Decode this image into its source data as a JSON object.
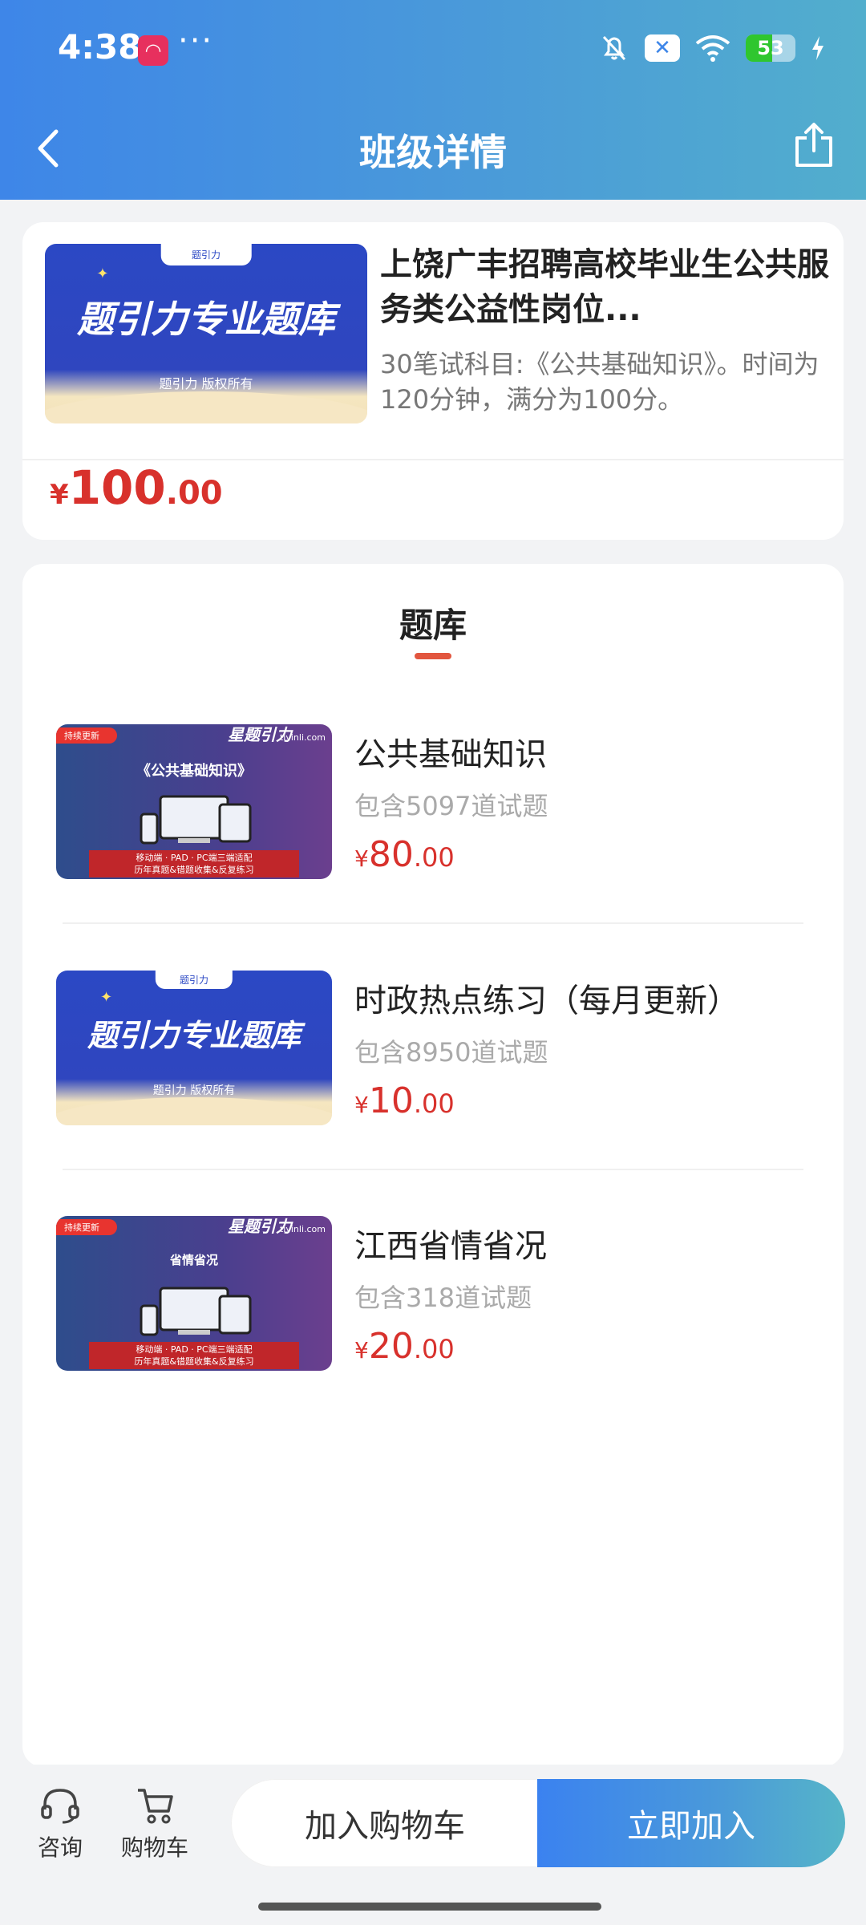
{
  "status_bar": {
    "time": "4:38",
    "more": "···",
    "battery_level": "53"
  },
  "header": {
    "title": "班级详情"
  },
  "course": {
    "thumbnail": {
      "title": "题引力专业题库",
      "tab_label": "题引力",
      "subtitle": "题引力 版权所有"
    },
    "title": "上饶广丰招聘高校毕业生公共服务类公益性岗位...",
    "description": "30笔试科目:《公共基础知识》。时间为120分钟，满分为100分。",
    "price": {
      "currency": "¥",
      "int": "100",
      "dec": ".00"
    }
  },
  "bank": {
    "section_title": "题库",
    "items": [
      {
        "title": "公共基础知识",
        "count": "包含5097道试题",
        "price": {
          "currency": "¥",
          "int": "80",
          "dec": ".00"
        },
        "thumbnail": {
          "ribbon": "持续更新",
          "logo": "星题引力",
          "url": "tiyinli.com",
          "title": "《公共基础知识》",
          "banner_line1": "移动端 · PAD · PC端三端适配",
          "banner_line2": "历年真题&错题收集&反复练习"
        }
      },
      {
        "title": "时政热点练习（每月更新）",
        "count": "包含8950道试题",
        "price": {
          "currency": "¥",
          "int": "10",
          "dec": ".00"
        },
        "thumbnail": {
          "title": "题引力专业题库",
          "tab_label": "题引力",
          "subtitle": "题引力 版权所有"
        }
      },
      {
        "title": "江西省情省况",
        "count": "包含318道试题",
        "price": {
          "currency": "¥",
          "int": "20",
          "dec": ".00"
        },
        "thumbnail": {
          "ribbon": "持续更新",
          "logo": "星题引力",
          "url": "tiyinli.com",
          "title": "省情省况",
          "banner_line1": "移动端 · PAD · PC端三端适配",
          "banner_line2": "历年真题&错题收集&反复练习"
        }
      }
    ]
  },
  "bottom_bar": {
    "consult_label": "咨询",
    "cart_label": "购物车",
    "add_cart_button": "加入购物车",
    "join_button": "立即加入"
  },
  "colors": {
    "accent_blue": "#3e86e8",
    "price_red": "#d8312c",
    "tab_underline": "#e2563f"
  }
}
